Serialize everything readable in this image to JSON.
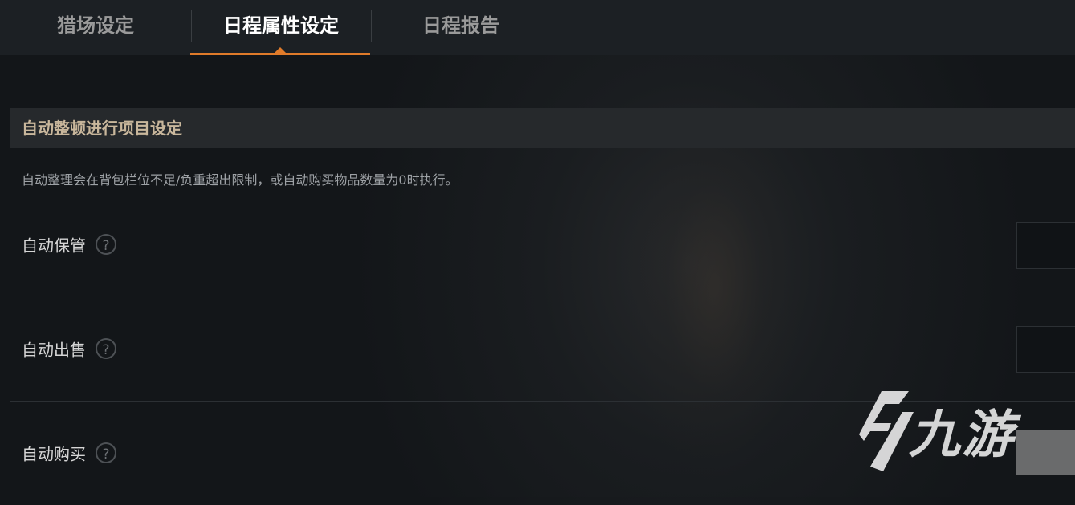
{
  "tabs": [
    {
      "label": "猎场设定",
      "active": false
    },
    {
      "label": "日程属性设定",
      "active": true
    },
    {
      "label": "日程报告",
      "active": false
    }
  ],
  "section": {
    "title": "自动整顿进行项目设定",
    "description": "自动整理会在背包栏位不足/负重超出限制，或自动购买物品数量为0时执行。"
  },
  "rows": [
    {
      "label": "自动保管",
      "help": "?"
    },
    {
      "label": "自动出售",
      "help": "?"
    },
    {
      "label": "自动购买",
      "help": "?"
    }
  ],
  "watermark": {
    "text": "九游"
  },
  "colors": {
    "accent": "#e07b2a",
    "section_title": "#c9b79c"
  }
}
